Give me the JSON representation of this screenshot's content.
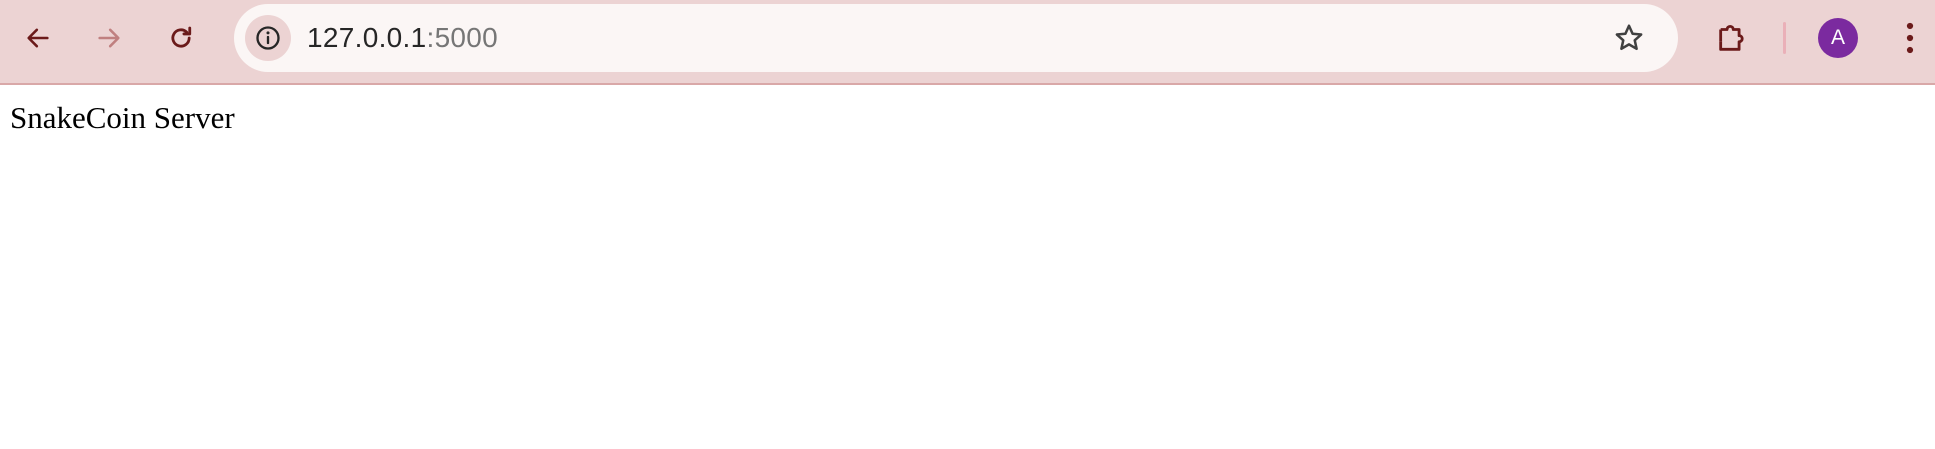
{
  "browser": {
    "url_host": "127.0.0.1",
    "url_port": ":5000",
    "profile_initial": "A",
    "icons": {
      "back": "back-arrow-icon",
      "forward": "forward-arrow-icon",
      "reload": "reload-icon",
      "site_info": "info-icon",
      "bookmark": "star-icon",
      "extensions": "puzzle-icon",
      "menu": "more-vertical-icon"
    },
    "colors": {
      "toolbar": "#ecd3d3",
      "icon": "#6b1a1a",
      "icon_disabled": "#c08080",
      "avatar": "#7b2a9f"
    }
  },
  "page": {
    "text": "SnakeCoin Server"
  }
}
